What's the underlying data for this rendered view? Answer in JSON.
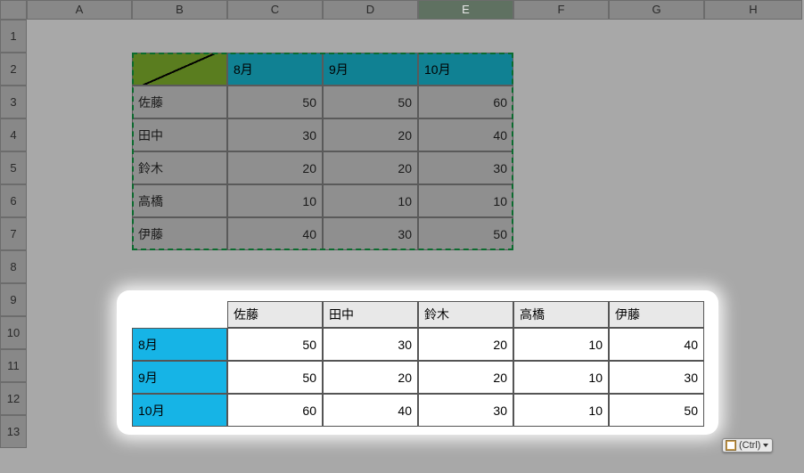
{
  "columns": [
    "A",
    "B",
    "C",
    "D",
    "E",
    "F",
    "G",
    "H"
  ],
  "active_column": "E",
  "rows": [
    1,
    2,
    3,
    4,
    5,
    6,
    7,
    8,
    9,
    10,
    11,
    12,
    13
  ],
  "source": {
    "months": [
      "8月",
      "9月",
      "10月"
    ],
    "names": [
      "佐藤",
      "田中",
      "鈴木",
      "高橋",
      "伊藤"
    ],
    "values": [
      [
        50,
        50,
        60
      ],
      [
        30,
        20,
        40
      ],
      [
        20,
        20,
        30
      ],
      [
        10,
        10,
        10
      ],
      [
        40,
        30,
        50
      ]
    ]
  },
  "transposed": {
    "names": [
      "佐藤",
      "田中",
      "鈴木",
      "高橋",
      "伊藤"
    ],
    "months": [
      "8月",
      "9月",
      "10月"
    ],
    "values": [
      [
        50,
        30,
        20,
        10,
        40
      ],
      [
        50,
        20,
        20,
        10,
        30
      ],
      [
        60,
        40,
        30,
        10,
        50
      ]
    ]
  },
  "paste_options_label": "(Ctrl)",
  "chart_data": {
    "type": "table",
    "title": "",
    "source_table": {
      "row_labels": [
        "佐藤",
        "田中",
        "鈴木",
        "高橋",
        "伊藤"
      ],
      "col_labels": [
        "8月",
        "9月",
        "10月"
      ],
      "values": [
        [
          50,
          50,
          60
        ],
        [
          30,
          20,
          40
        ],
        [
          20,
          20,
          30
        ],
        [
          10,
          10,
          10
        ],
        [
          40,
          30,
          50
        ]
      ]
    },
    "transposed_table": {
      "row_labels": [
        "8月",
        "9月",
        "10月"
      ],
      "col_labels": [
        "佐藤",
        "田中",
        "鈴木",
        "高橋",
        "伊藤"
      ],
      "values": [
        [
          50,
          30,
          20,
          10,
          40
        ],
        [
          50,
          20,
          20,
          10,
          30
        ],
        [
          60,
          40,
          30,
          10,
          50
        ]
      ]
    }
  }
}
